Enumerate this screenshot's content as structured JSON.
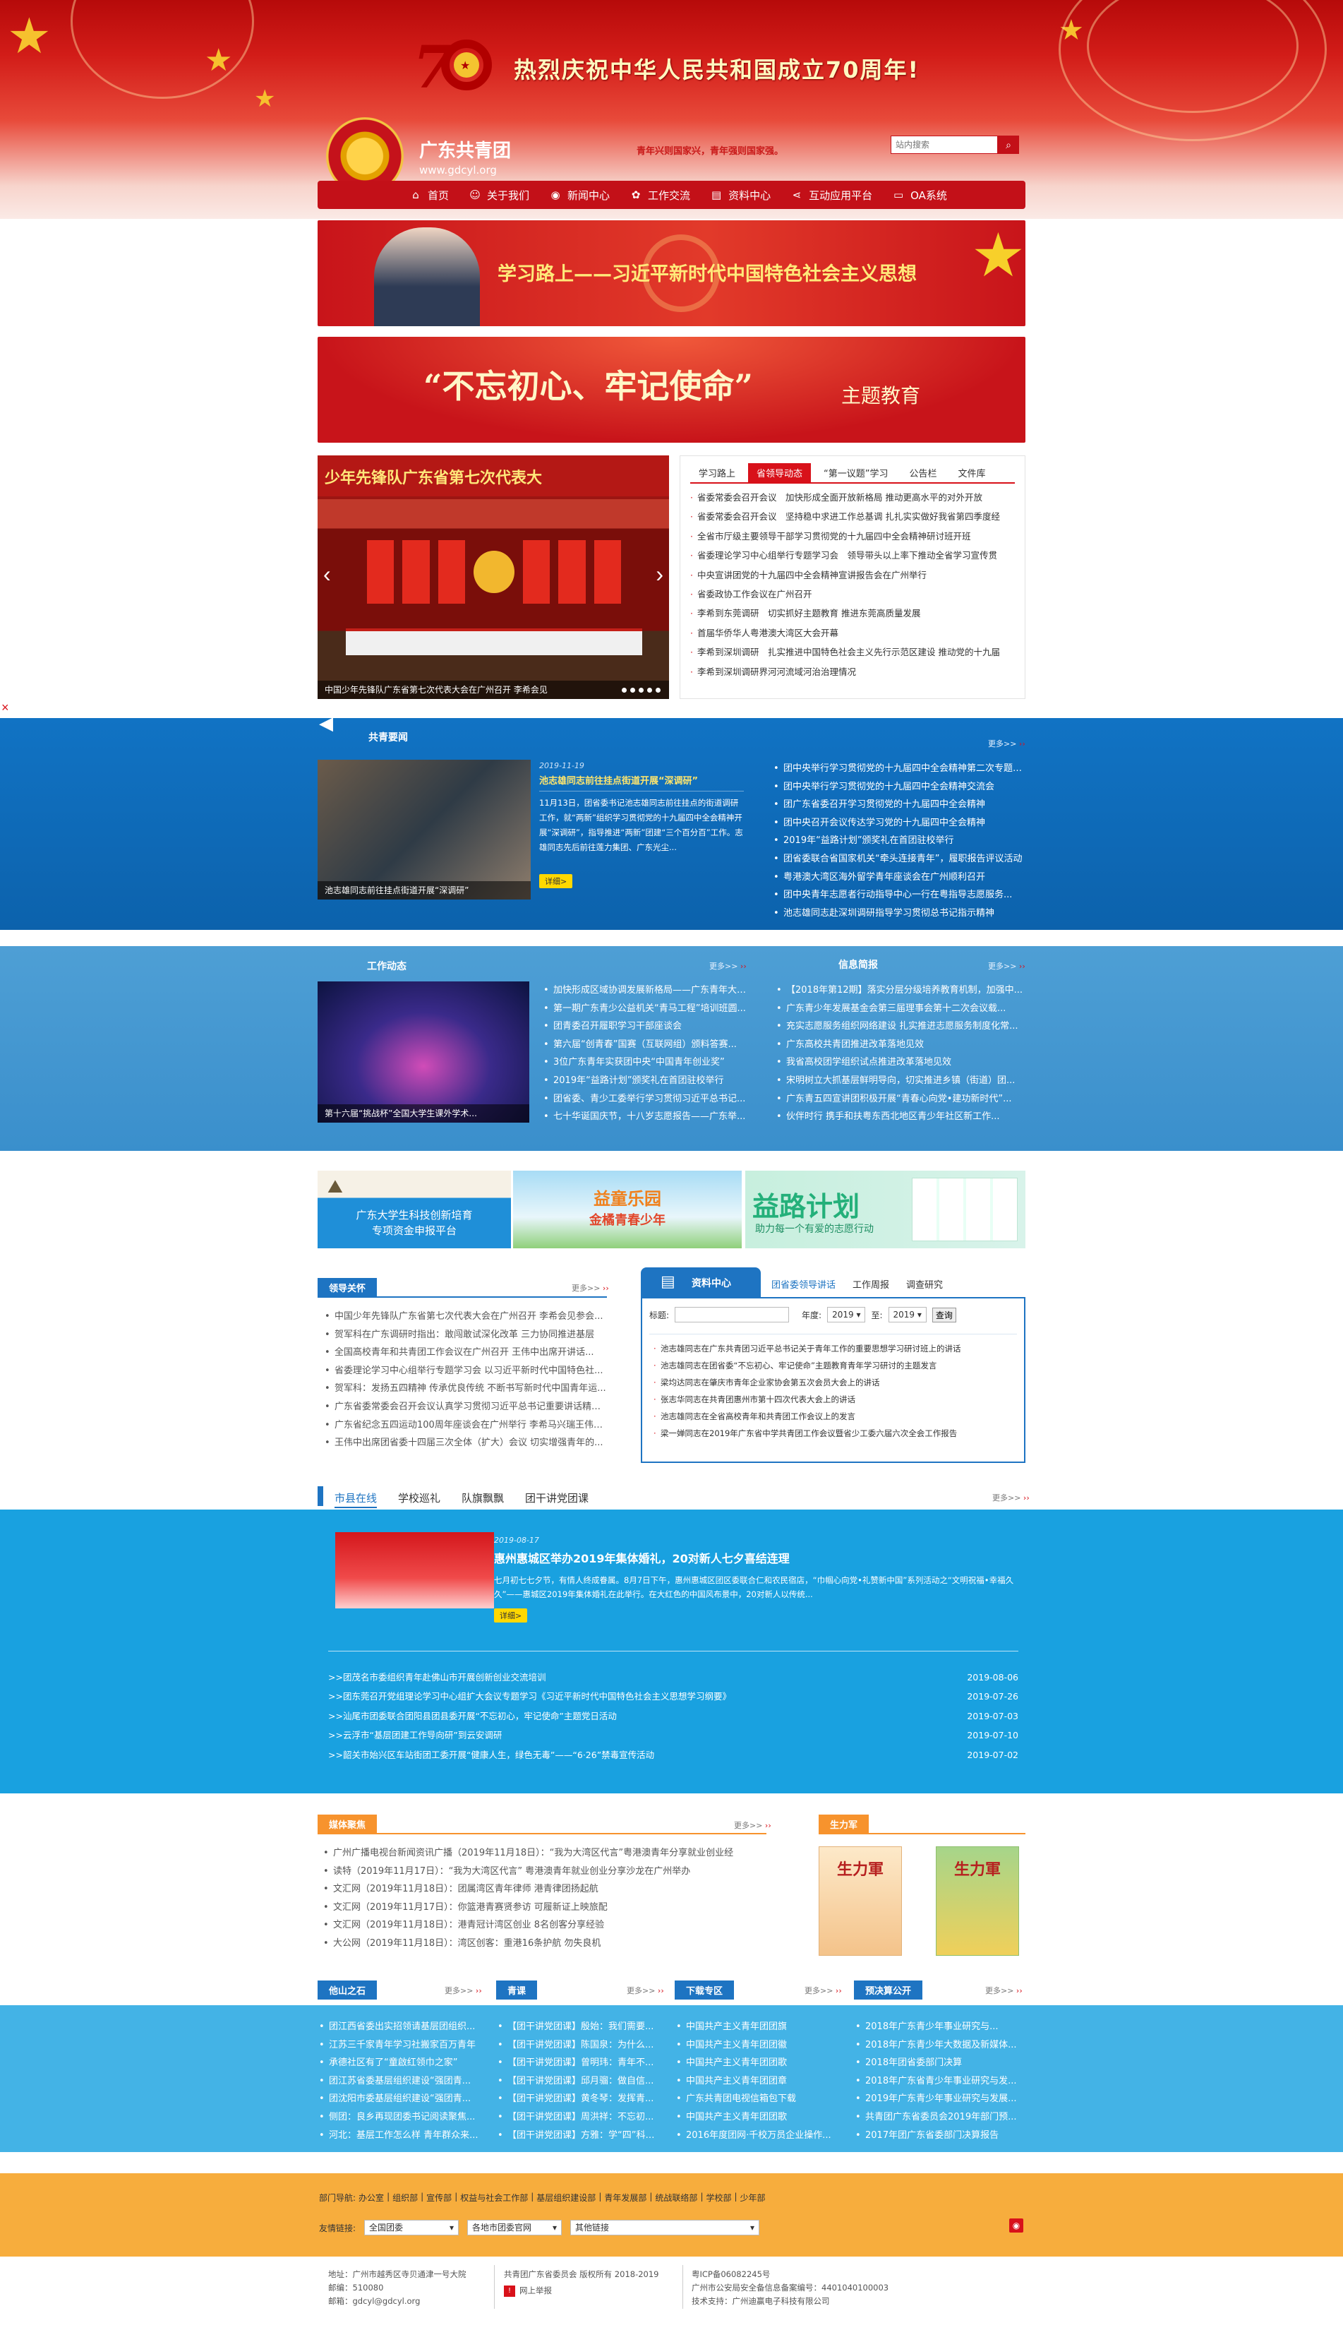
{
  "header": {
    "anniversary": "热烈庆祝中华人民共和国成立70周年!",
    "site_name": "广东共青团",
    "site_url": "www.gdcyl.org",
    "slogan": "青年兴则国家兴，青年强则国家强。",
    "search_placeholder": "站内搜索",
    "nav": [
      "首页",
      "关于我们",
      "新闻中心",
      "工作交流",
      "资料中心",
      "互动应用平台",
      "OA系统"
    ]
  },
  "banners": {
    "study": "学习路上——习近平新时代中国特色社会主义思想",
    "theme_quote": "“不忘初心、牢记使命”",
    "theme_suffix": "主题教育"
  },
  "slider": {
    "title_text": "少年先锋队广东省第七次代表大",
    "caption": "中国少年先锋队广东省第七次代表大会在广州召开 李希会见"
  },
  "study_tabs": {
    "tabs": [
      "学习路上",
      "省领导动态",
      "“第一议题”学习",
      "公告栏",
      "文件库"
    ],
    "items": [
      "省委常委会召开会议　加快形成全面开放新格局 推动更高水平的对外开放",
      "省委常委会召开会议　坚持稳中求进工作总基调 扎扎实实做好我省第四季度经",
      "全省市厅级主要领导干部学习贯彻党的十九届四中全会精神研讨班开班",
      "省委理论学习中心组举行专题学习会　领导带头以上率下推动全省学习宣传贯",
      "中央宣讲团党的十九届四中全会精神宣讲报告会在广州举行",
      "省委政协工作会议在广州召开",
      "李希到东莞调研　切实抓好主题教育 推进东莞高质量发展",
      "首届华侨华人粤港澳大湾区大会开幕",
      "李希到深圳调研　扎实推进中国特色社会主义先行示范区建设 推动党的十九届",
      "李希到深圳调研界河河流域河治治理情况"
    ]
  },
  "side_float": {
    "close": "×"
  },
  "gq_news": {
    "title": "共青要闻",
    "more": "更多>>",
    "date": "2019-11-19",
    "headline": "池志雄同志前往挂点街道开展“深调研”",
    "summary": "11月13日，团省委书记池志雄同志前往挂点的街道调研工作，就“两新”组织学习贯彻党的十九届四中全会精神开展“深调研”，指导推进“两新”团建“三个百分百”工作。志雄同志先后前往莲力集团、广东光尘...",
    "detail": "详细>",
    "photo_caption": "池志雄同志前往挂点街道开展“深调研”",
    "items": [
      "团中央举行学习贯彻党的十九届四中全会精神第二次专题交流会",
      "团中央举行学习贯彻党的十九届四中全会精神交流会",
      "团广东省委召开学习贯彻党的十九届四中全会精神",
      "团中央召开会议传达学习党的十九届四中全会精神",
      "2019年“益路计划”颁奖礼在首团驻校举行",
      "团省委联合省国家机关“牵头连接青年”，履职报告评议活动",
      "粤港澳大湾区海外留学青年座谈会在广州顺利召开",
      "团中央青年志愿者行动指导中心一行在粤指导志愿服务...",
      "池志雄同志赴深圳调研指导学习贯彻总书记指示精神"
    ]
  },
  "work": {
    "title": "工作动态",
    "more": "更多>>",
    "photo_caption": "第十六届“挑战杯”全国大学生课外学术...",
    "items": [
      "加快形成区域协调发展新格局——广东青年大学...",
      "第一期广东青少公益机关“青马工程”培训班圆...",
      "团青委召开履职学习干部座谈会",
      "第六届“创青春”国赛（互联网组）颁料答赛...",
      "3位广东青年实获团中央“中国青年创业奖”",
      "2019年“益路计划”颁奖礼在首团驻校举行",
      "团省委、青少工委举行学习贯彻习近平总书记...",
      "七十华诞国庆节，十八岁志愿报告——广东举..."
    ]
  },
  "info": {
    "title": "信息简报",
    "more": "更多>>",
    "items": [
      "【2018年第12期】落实分层分级培养教育机制，加强中...",
      "广东青少年发展基金会第三届理事会第十二次会议载...",
      "充实志愿服务组织网络建设 扎实推进志愿服务制度化常...",
      "广东高校共青团推进改革落地见效",
      "我省高校团学组织试点推进改革落地见效",
      "宋明树立大抓基层鲜明导向，切实推进乡镇（街道）团...",
      "广东青五四宣讲团积极开展“青春心向党•建功新时代”...",
      "伙伴时行 携手和扶粤东西北地区青少年社区新工作..."
    ]
  },
  "promos": {
    "p1_line1": "广东大学生科技创新培育",
    "p1_line2": "专项资金申报平台",
    "p2_line1": "益童乐园",
    "p2_line2": "金橘青春少年",
    "p3_line1": "益路计划",
    "p3_line2": "助力每一个有爱的志愿行动"
  },
  "leaders": {
    "title": "领导关怀",
    "more": "更多>>",
    "items": [
      "中国少年先锋队广东省第七次代表大会在广州召开 李希会见参会...",
      "贺军科在广东调研时指出：敢闯敢试深化改革 三力协同推进基层",
      "全国高校青年和共青团工作会议在广州召开 王伟中出席开讲话...",
      "省委理论学习中心组举行专题学习会 以习近平新时代中国特色社...",
      "贺军科：发扬五四精神 传承优良传统 不断书写新时代中国青年运...",
      "广东省委常委会召开会议认真学习贯彻习近平总书记重要讲话精神...",
      "广东省纪念五四运动100周年座谈会在广州举行 李希马兴瑞王伟中...",
      "王伟中出席团省委十四届三次全体（扩大）会议 切实增强青年的..."
    ]
  },
  "resource": {
    "head": "资料中心",
    "tabs": [
      "团省委领导讲话",
      "工作周报",
      "调查研究"
    ],
    "title_label": "标题:",
    "year_label": "年度:",
    "to_label": "至:",
    "year_from": "2019",
    "year_to": "2019",
    "query": "查询",
    "items": [
      "池志雄同志在广东共青团习近平总书记关于青年工作的重要思想学习研讨班上的讲话",
      "池志雄同志在团省委“不忘初心、牢记使命”主题教育青年学习研讨的主题发言",
      "梁均达同志在肇庆市青年企业家协会第五次会员大会上的讲话",
      "张志华同志在共青团惠州市第十四次代表大会上的讲话",
      "池志雄同志在全省高校青年和共青团工作会议上的发言",
      "梁一婵同志在2019年广东省中学共青团工作会议暨省少工委六届六次全会工作报告"
    ]
  },
  "city": {
    "tabs": [
      "市县在线",
      "学校巡礼",
      "队旗飘飘",
      "团干讲党团课"
    ],
    "more": "更多>>",
    "date": "2019-08-17",
    "headline": "惠州惠城区举办2019年集体婚礼，20对新人七夕喜结连理",
    "summary": "七月初七七夕节，有情人终成眷属。8月7日下午，惠州惠城区团区委联合仁和农民宿店，“巾帼心向党•礼赞新中国”系列活动之“文明祝福•幸福久久”——惠城区2019年集体婚礼在此举行。在大红色的中国风布景中，20对新人以传统...",
    "detail": "详细>",
    "rows": [
      {
        "t": ">>团茂名市委组织青年赴佛山市开展创新创业交流培训",
        "d": "2019-08-06"
      },
      {
        "t": ">>团东莞召开党组理论学习中心组扩大会议专题学习《习近平新时代中国特色社会主义思想学习纲要》",
        "d": "2019-07-26"
      },
      {
        "t": ">>汕尾市团委联合团阳县团县委开展“不忘初心，牢记使命”主题党日活动",
        "d": "2019-07-03"
      },
      {
        "t": ">>云浮市“基层团建工作导向研”到云安调研",
        "d": "2019-07-10"
      },
      {
        "t": ">>韶关市始兴区车站街团工委开展“健康人生，绿色无毒”——“6·26”禁毒宣传活动",
        "d": "2019-07-02"
      }
    ]
  },
  "media": {
    "title": "媒体聚焦",
    "more": "更多>>",
    "items": [
      "广州广播电视台新闻资讯广播（2019年11月18日）：“我为大湾区代言”粤港澳青年分享就业创业经",
      "读特（2019年11月17日）：“我为大湾区代言” 粤港澳青年就业创业分享沙龙在广州举办",
      "文汇网（2019年11月18日）：团属湾区青年律师 港青律团扬起航",
      "文汇网（2019年11月17日）：你篮港青赛贤参访 可履新证上映旅配",
      "文汇网（2019年11月18日）：港青冠计湾区创业 8名创客分享经验",
      "大公网（2019年11月18日）：湾区创客：重港16条护航 勿失良机"
    ]
  },
  "shengli": {
    "title": "生力军",
    "mag1": "生力軍",
    "mag2": "生力軍"
  },
  "bottom_cols": [
    {
      "title": "他山之石",
      "more": "更多>>",
      "items": [
        "团江西省委出实招领请基层团组织...",
        "江苏三千家青年学习社搬家百万青年",
        "承德社区有了“童啟红领巾之家”",
        "团江苏省委基层组织建设“强团青...",
        "团沈阳市委基层组织建设“强团青...",
        "侧团：良乡再现团委书记阅读聚焦...",
        "河北：基层工作怎么样 青年群众来..."
      ]
    },
    {
      "title": "青课",
      "more": "更多>>",
      "items": [
        "【团干讲党团课】殷始：我们需要...",
        "【团干讲党团课】陈国泉：为什么...",
        "【团干讲党团课】曾明玮：青年不...",
        "【团干讲党团课】邱月骝：做自信...",
        "【团干讲党团课】黄冬琴：发挥青...",
        "【团干讲党团课】周洪祥：不忘初...",
        "【团干讲党团课】方雅：学“四”科学..."
      ]
    },
    {
      "title": "下载专区",
      "more": "更多>>",
      "items": [
        "中国共产主义青年团团旗",
        "中国共产主义青年团团徽",
        "中国共产主义青年团团歌",
        "中国共产主义青年团团章",
        "广东共青团电视信箱包下载",
        "中国共产主义青年团团歌",
        "2016年度团网·千校万员企业操作..."
      ]
    },
    {
      "title": "预决算公开",
      "more": "更多>>",
      "items": [
        "2018年广东青少年事业研究与...",
        "2018年广东青少年大数据及新媒体...",
        "2018年团省委部门决算",
        "2018年广东省青少年事业研究与发...",
        "2019年广东青少年事业研究与发展...",
        "共青团广东省委员会2019年部门预...",
        "2017年团广东省委部门决算报告"
      ]
    }
  ],
  "footer": {
    "dept_label": "部门导航:",
    "depts": [
      "办公室",
      "组织部",
      "宣传部",
      "权益与社会工作部",
      "基层组织建设部",
      "青年发展部",
      "统战联络部",
      "学校部",
      "少年部"
    ],
    "links_label": "友情链接:",
    "link_selects": [
      "全国团委",
      "各地市团委官网",
      "其他链接"
    ],
    "addr1": "地址：广州市越秀区寺贝通津一号大院",
    "addr2": "邮编：510080",
    "addr3": "邮箱：gdcyl@gdcyl.org",
    "copy1": "共青团广东省委员会 版权所有 2018-2019",
    "report": "网上举报",
    "icp1": "粤ICP备06082245号",
    "icp2": "广州市公安局安全备信息备案编号：4401040100003",
    "icp3": "技术支持：广州迪赢电子科技有限公司"
  },
  "colors": {
    "red": "#d8111a",
    "blue_band": "#0f6db9",
    "blue_mid": "#3a95cf",
    "sky": "#19a1e0",
    "orange": "#f7ad3d"
  }
}
